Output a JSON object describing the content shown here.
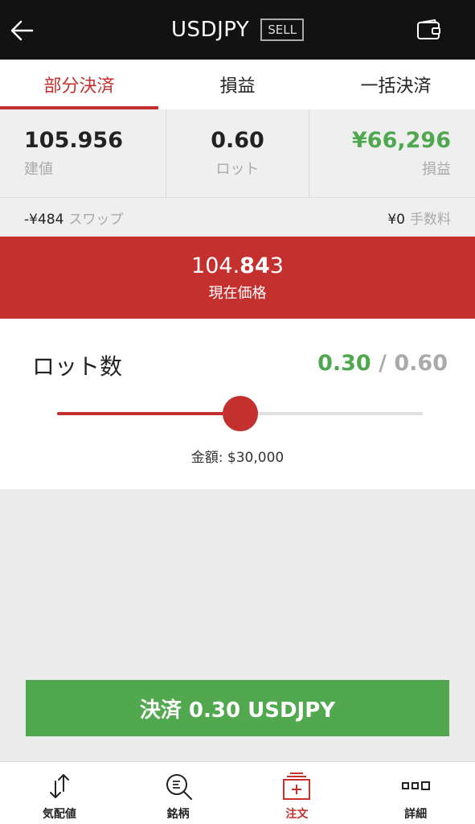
{
  "header": {
    "title": "USDJPY",
    "badge": "SELL"
  },
  "tabs": [
    {
      "label": "部分決済",
      "active": true
    },
    {
      "label": "損益",
      "active": false
    },
    {
      "label": "一括決済",
      "active": false
    }
  ],
  "stats": {
    "entry": {
      "value": "105.956",
      "label": "建値"
    },
    "lot": {
      "value": "0.60",
      "label": "ロット"
    },
    "pnl": {
      "value": "¥66,296",
      "label": "損益"
    }
  },
  "swap": {
    "value": "-¥484",
    "label": "スワップ"
  },
  "fee": {
    "value": "¥0",
    "label": "手数料"
  },
  "price": {
    "prefix": "104.",
    "bold": "84",
    "suffix": "3",
    "label": "現在価格"
  },
  "lot_panel": {
    "label": "ロット数",
    "current": "0.30",
    "separator": "/",
    "max": "0.60",
    "slider_fraction": 0.5,
    "amount": "金額: $30,000"
  },
  "settle_button": "決済 0.30 USDJPY",
  "nav": [
    {
      "label": "気配値",
      "icon": "quotes-icon",
      "active": false
    },
    {
      "label": "銘柄",
      "icon": "symbol-search-icon",
      "active": false
    },
    {
      "label": "注文",
      "icon": "order-icon",
      "active": true
    },
    {
      "label": "詳細",
      "icon": "more-icon",
      "active": false
    }
  ],
  "colors": {
    "accent": "#c4302e",
    "positive": "#4fa84f",
    "header_bg": "#121212"
  }
}
